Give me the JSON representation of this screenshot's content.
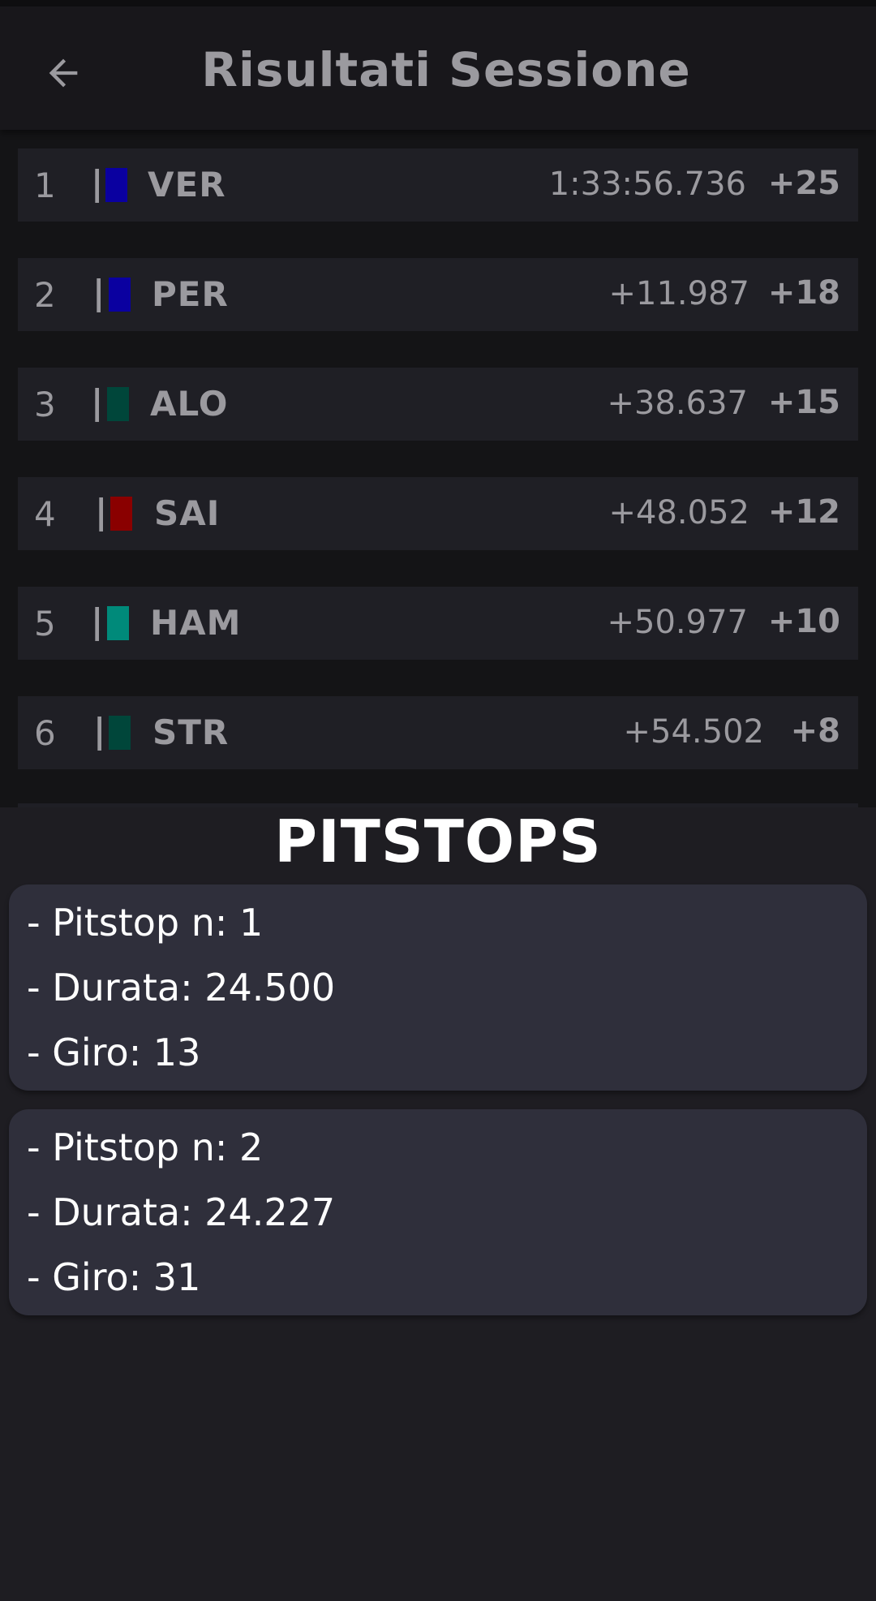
{
  "header": {
    "title": "Risultati Sessione",
    "back_icon": "arrow-left-icon"
  },
  "results": [
    {
      "position": "1",
      "separator": "|",
      "team_color": "#0a00a0",
      "driver": "VER",
      "time": "1:33:56.736",
      "points": "+25"
    },
    {
      "position": "2",
      "separator": "|",
      "team_color": "#0a00a0",
      "driver": "PER",
      "time": "+11.987",
      "points": "+18"
    },
    {
      "position": "3",
      "separator": "|",
      "team_color": "#00463a",
      "driver": "ALO",
      "time": "+38.637",
      "points": "+15"
    },
    {
      "position": "4",
      "separator": "|",
      "team_color": "#8a0000",
      "driver": "SAI",
      "time": "+48.052",
      "points": "+12"
    },
    {
      "position": "5",
      "separator": "|",
      "team_color": "#008a7a",
      "driver": "HAM",
      "time": "+50.977",
      "points": "+10"
    },
    {
      "position": "6",
      "separator": "|",
      "team_color": "#00463a",
      "driver": "STR",
      "time": "+54.502",
      "points": "+8"
    }
  ],
  "pitstops": {
    "title": "PITSTOPS",
    "items": [
      {
        "number_line": "- Pitstop n: 1",
        "duration_line": "- Durata: 24.500",
        "lap_line": "- Giro: 13"
      },
      {
        "number_line": "- Pitstop n: 2",
        "duration_line": "- Durata: 24.227",
        "lap_line": "- Giro: 31"
      }
    ]
  }
}
